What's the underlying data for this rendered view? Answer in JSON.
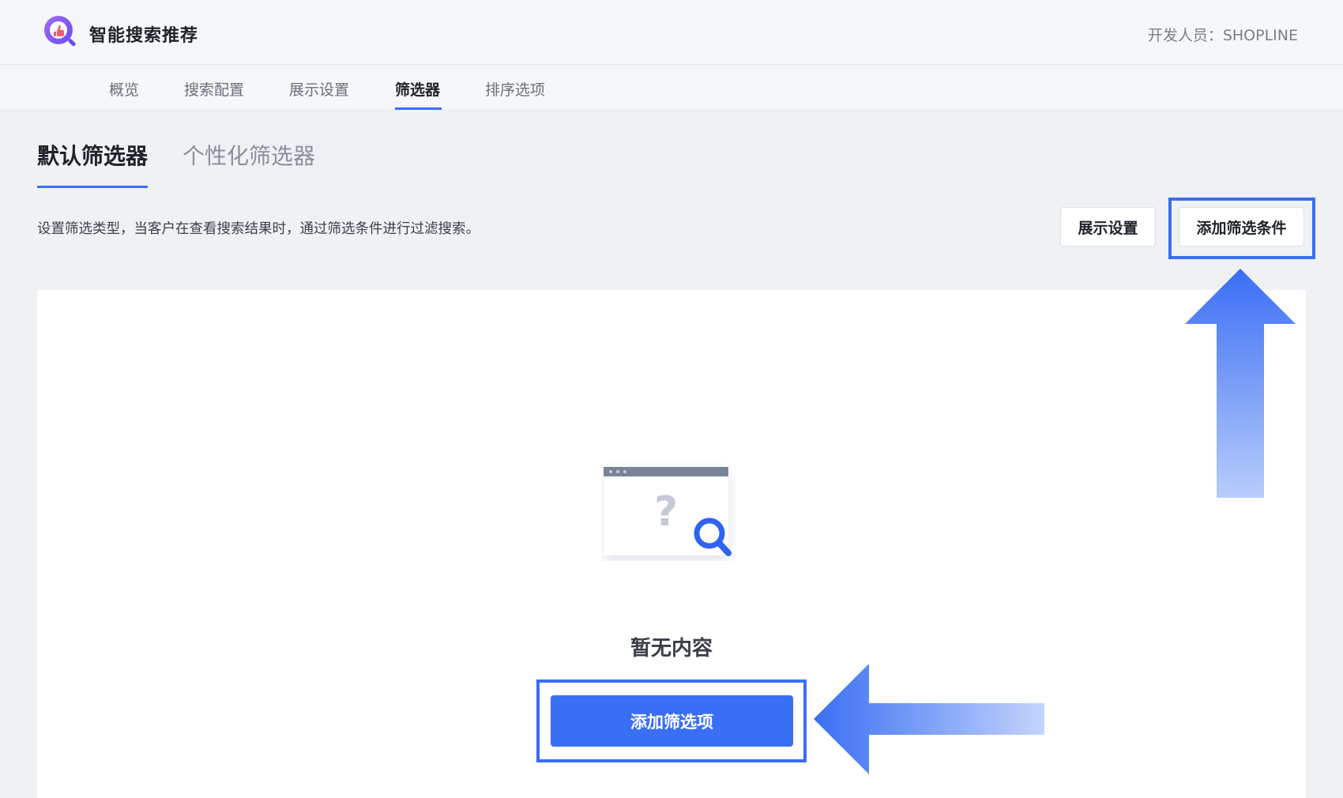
{
  "header": {
    "app_title": "智能搜索推荐",
    "developer": "开发人员：SHOPLINE"
  },
  "nav": {
    "tabs": [
      {
        "label": "概览"
      },
      {
        "label": "搜索配置"
      },
      {
        "label": "展示设置"
      },
      {
        "label": "筛选器"
      },
      {
        "label": "排序选项"
      }
    ],
    "active": "筛选器"
  },
  "subtabs": {
    "default_label": "默认筛选器",
    "personal_label": "个性化筛选器"
  },
  "description": "设置筛选类型，当客户在查看搜索结果时，通过筛选条件进行过滤搜索。",
  "actions": {
    "display_settings_label": "展示设置",
    "add_condition_label": "添加筛选条件"
  },
  "empty_state": {
    "text": "暂无内容",
    "add_button_label": "添加筛选项",
    "illustration_icon": "question-search-icon"
  },
  "colors": {
    "accent": "#3a6ef4",
    "background": "#f0f1f5",
    "logo": "#8a5cf5"
  }
}
